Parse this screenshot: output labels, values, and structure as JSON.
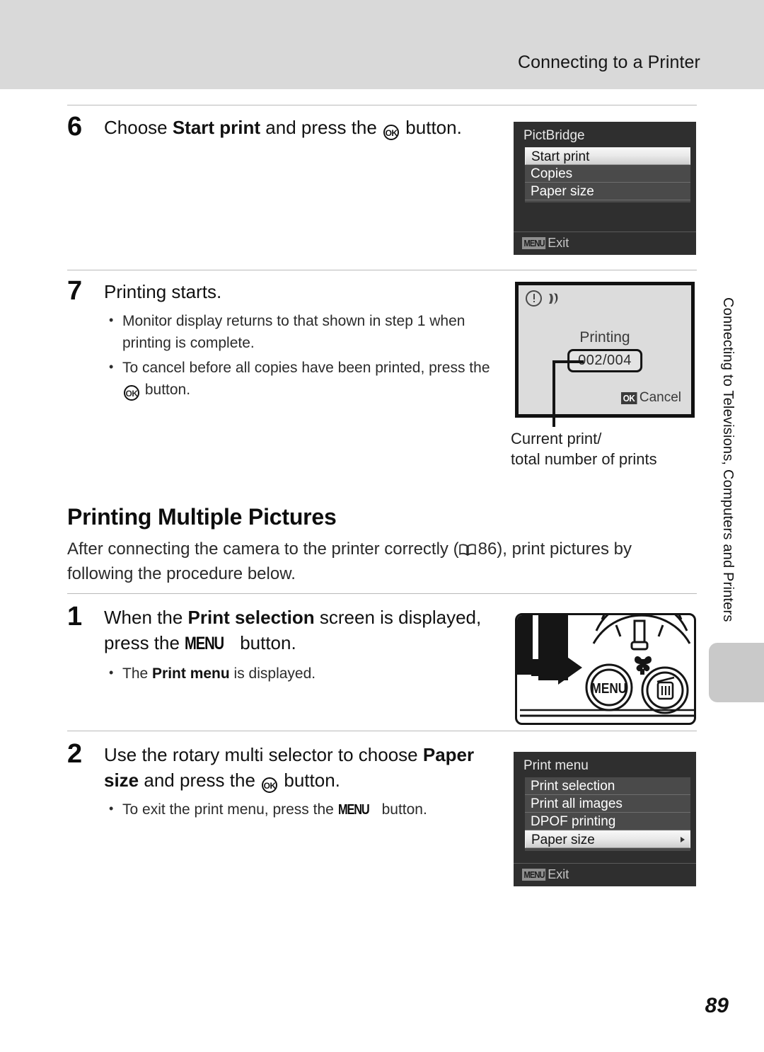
{
  "header": {
    "title": "Connecting to a Printer"
  },
  "side_tab": {
    "text": "Connecting to Televisions, Computers and Printers"
  },
  "page_number": "89",
  "steps": [
    {
      "number": "6",
      "title_pre": "Choose ",
      "title_bold": "Start print",
      "title_mid": " and press the ",
      "ok_glyph": "OK",
      "title_post": " button."
    },
    {
      "number": "7",
      "title": "Printing starts.",
      "bullets": [
        "Monitor display returns to that shown in step 1 when printing is complete.",
        "To cancel before all copies have been printed, press the"
      ],
      "bullet2_post": "button."
    },
    {
      "number": "1",
      "title_pre": "When the ",
      "title_bold": "Print selection",
      "title_mid": " screen is displayed, press the ",
      "menu_glyph": "MENU",
      "title_post": " button.",
      "bullet_pre": "The ",
      "bullet_bold": "Print menu",
      "bullet_post": " is displayed."
    },
    {
      "number": "2",
      "title_pre": "Use the rotary multi selector to choose ",
      "title_bold": "Paper size",
      "title_mid": " and press the ",
      "ok_glyph": "OK",
      "title_post": " button.",
      "bullet_pre": "To exit the print menu, press the ",
      "menu_glyph": "MENU",
      "bullet_post": " button."
    }
  ],
  "section": {
    "heading": "Printing Multiple Pictures",
    "para_pre": "After connecting the camera to the printer correctly (",
    "para_ref": "86",
    "para_post": "), print pictures by following the procedure below."
  },
  "pictbridge_screen": {
    "title": "PictBridge",
    "items": [
      {
        "label": "Start print",
        "selected": true
      },
      {
        "label": "Copies",
        "selected": false
      },
      {
        "label": "Paper size",
        "selected": false
      }
    ],
    "footer_chip": "MENU",
    "footer_label": "Exit"
  },
  "printing_screen": {
    "status": "Printing",
    "count": "002/004",
    "ok_chip": "OK",
    "cancel_label": "Cancel",
    "callout_line1": "Current print/",
    "callout_line2": "total number of prints"
  },
  "camera_figure": {
    "menu_button_label": "MENU"
  },
  "print_menu_screen": {
    "title": "Print menu",
    "items": [
      {
        "label": "Print selection",
        "selected": false,
        "submenu": false
      },
      {
        "label": "Print all images",
        "selected": false,
        "submenu": false
      },
      {
        "label": "DPOF printing",
        "selected": false,
        "submenu": false
      },
      {
        "label": "Paper size",
        "selected": true,
        "submenu": true
      }
    ],
    "footer_chip": "MENU",
    "footer_label": "Exit"
  },
  "colors": {
    "header_band": "#d9d9d9",
    "lcd_dark": "#2f2f2f",
    "lcd_list": "#4a4a4a",
    "lcd_light": "#dcdcdc",
    "tab_gray": "#c9c9c9"
  }
}
